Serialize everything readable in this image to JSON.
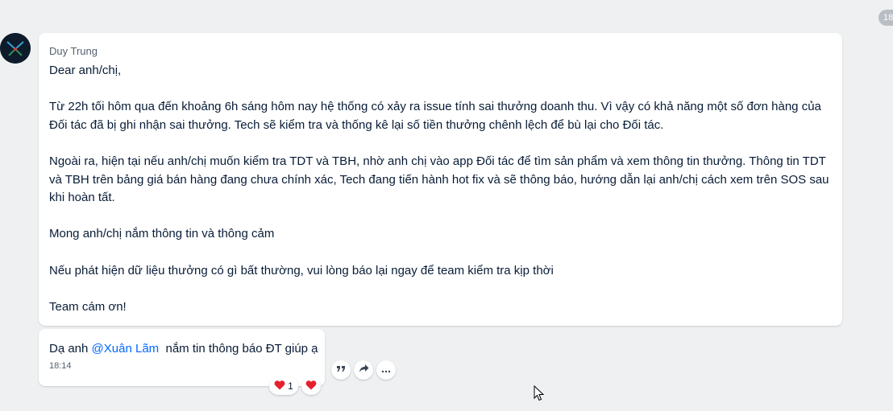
{
  "date_badge": "18",
  "message": {
    "sender": "Duy Trung",
    "body": "Dear anh/chị,\n\nTừ 22h tối hôm qua đến khoảng 6h sáng hôm nay hệ thống có xảy ra issue tính sai thưởng doanh thu. Vì vậy có khả năng một số đơn hàng của\nĐối tác đã bị ghi nhận sai thưởng. Tech sẽ kiểm tra và thống kê lại số tiền thưởng chênh lệch để bù lại cho Đối tác.\n\nNgoài ra, hiện tại nếu anh/chị muốn kiểm tra TDT và TBH, nhờ anh chị vào app Đối tác để tìm sản phẩm và xem thông tin thưởng. Thông tin TDT\nvà TBH trên bảng giá bán hàng đang chưa chính xác, Tech đang tiến hành hot fix và sẽ thông báo, hướng dẫn lại anh/chị cách xem trên SOS sau\nkhi hoàn tất.\n\nMong anh/chị nắm thông tin và thông cảm\n\nNếu phát hiện dữ liệu thưởng có gì bất thường, vui lòng báo lại ngay để team kiểm tra kịp thời\n\nTeam cám ơn!"
  },
  "reply": {
    "prefix": "Dạ anh ",
    "mention": "@Xuân Lãm",
    "suffix": "  nắm tin thông báo ĐT giúp ạ",
    "time": "18:14",
    "reaction_count": "1"
  },
  "icons": {
    "quote": "quote-icon",
    "share": "share-icon",
    "more": "more-icon",
    "heart": "heart-icon"
  },
  "colors": {
    "background": "#eef0f1",
    "mention": "#0068ff",
    "heart": "#e5202e"
  }
}
